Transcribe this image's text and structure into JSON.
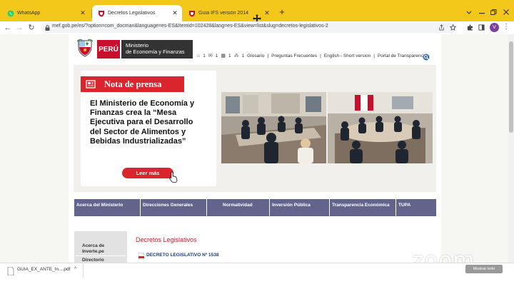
{
  "browser": {
    "tabs": [
      {
        "title": "WhatsApp",
        "active": false
      },
      {
        "title": "Decretos Legislativos",
        "active": true
      },
      {
        "title": "Guía IFS versión 2014",
        "active": false
      }
    ],
    "url": "mef.gob.pe/es/?option=com_docman&language=es-ES&Itemid=102428&lang=es-ES&view=list&slug=decretos-legislativos-2",
    "profile_initial": "V",
    "accent_color": "#f3c81a"
  },
  "site": {
    "logo": {
      "country": "PERÚ",
      "ministry_line1": "Ministerio",
      "ministry_line2": "de Economía y Finanzas"
    },
    "toplinks": [
      {
        "icon": "home-icon",
        "sep": "1"
      },
      {
        "icon": "mail-icon",
        "sep": "1"
      },
      {
        "icon": "sitemap-icon",
        "sep": "1"
      },
      {
        "icon": "network-icon",
        "sep": "1"
      }
    ],
    "links": [
      "Glosario",
      "|",
      "Preguntas Frecuentes",
      "|",
      "English - Short version",
      "|",
      "Portal de Transparencia"
    ],
    "banner": {
      "label": "Nota de prensa",
      "headline": "El Ministerio de Economía y Finanzas crea la “Mesa Ejecutiva para el Desarrollo del Sector de Alimentos y Bebidas Industrializadas”",
      "button": "Leer más"
    },
    "menu": [
      {
        "label": "Acerca del Ministerio"
      },
      {
        "label": "Direcciones Generales"
      },
      {
        "label": "Normatividad"
      },
      {
        "label": "Inversión Pública"
      },
      {
        "label": "Transparencia Económica"
      },
      {
        "label": "TUPA"
      }
    ],
    "sidebar": {
      "item1_line1": "Acerca de",
      "item1_line2": "Inverte.pe",
      "item2": "Directorio"
    },
    "section_title": "Decretos Legislativos",
    "documents": [
      "DECRETO LEGISLATIVO Nº 1538"
    ]
  },
  "overlay": {
    "zoom_logo": "zoom",
    "toast": "Mostrar todo"
  },
  "downloads": {
    "file": "GUIA_EX_ANTE_In....pdf"
  },
  "colors": {
    "brand_red": "#d9252b",
    "menu_bg": "#62648e",
    "section_title": "#c1272d"
  }
}
